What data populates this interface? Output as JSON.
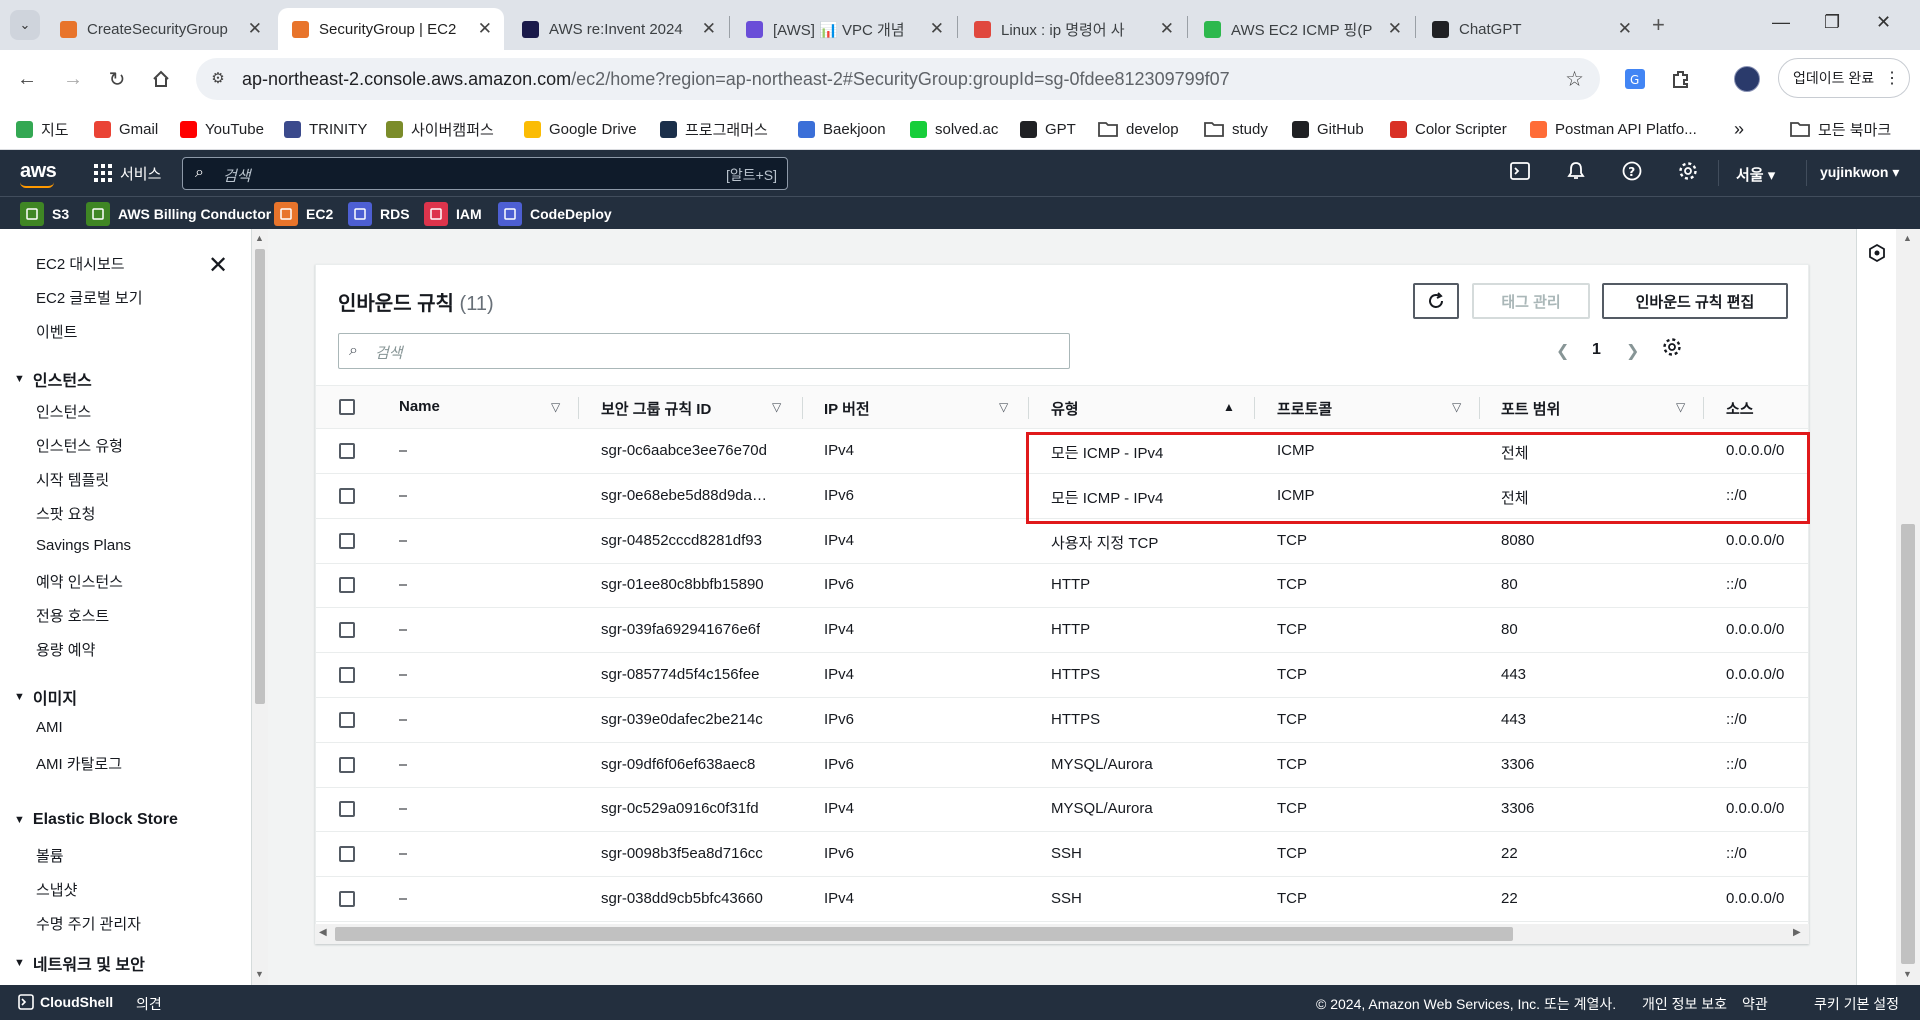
{
  "browser": {
    "tabs": [
      {
        "title": "CreateSecurityGroup",
        "fav_color": "#e8742b",
        "active": false
      },
      {
        "title": "SecurityGroup | EC2",
        "fav_color": "#e8742b",
        "active": true
      },
      {
        "title": "AWS re:Invent 2024",
        "fav_color": "#1a1a4a",
        "active": false
      },
      {
        "title": "[AWS] 📊 VPC 개념",
        "fav_color": "#6a4ed8",
        "active": false
      },
      {
        "title": "Linux : ip 명령어 사",
        "fav_color": "#e0483e",
        "active": false
      },
      {
        "title": "AWS EC2 ICMP 핑(P",
        "fav_color": "#2db84d",
        "active": false
      },
      {
        "title": "ChatGPT",
        "fav_color": "#202124",
        "active": false
      }
    ],
    "url_domain": "ap-northeast-2.console.aws.amazon.com",
    "url_path": "/ec2/home?region=ap-northeast-2#SecurityGroup:groupId=sg-0fdee812309799f07",
    "update_label": "업데이트 완료",
    "bookmarks": [
      {
        "label": "지도",
        "color": "#34a853"
      },
      {
        "label": "Gmail",
        "color": "#ea4335"
      },
      {
        "label": "YouTube",
        "color": "#ff0000"
      },
      {
        "label": "TRINITY",
        "color": "#3b4a8c"
      },
      {
        "label": "사이버캠퍼스",
        "color": "#7b8c2a"
      },
      {
        "label": "Google Drive",
        "color": "#fbbc04"
      },
      {
        "label": "프로그래머스",
        "color": "#1b2f4a"
      },
      {
        "label": "Baekjoon",
        "color": "#3b6fd8"
      },
      {
        "label": "solved.ac",
        "color": "#17ce3a"
      },
      {
        "label": "GPT",
        "color": "#202124"
      },
      {
        "label": "develop",
        "color": "#ffffff"
      },
      {
        "label": "study",
        "color": "#ffffff"
      },
      {
        "label": "GitHub",
        "color": "#202124"
      },
      {
        "label": "Color Scripter",
        "color": "#d93025"
      },
      {
        "label": "Postman API Platfo...",
        "color": "#ff6c37"
      }
    ],
    "bookmarks_more": "»",
    "all_bookmarks": "모든 북마크"
  },
  "aws": {
    "services_label": "서비스",
    "search_placeholder": "검색",
    "search_shortcut": "[알트+S]",
    "region": "서울 ▾",
    "user": "yujinkwon ▾",
    "favorites": [
      {
        "label": "S3",
        "color": "#3f8624"
      },
      {
        "label": "AWS Billing Conductor",
        "color": "#3f8624"
      },
      {
        "label": "EC2",
        "color": "#e8742b"
      },
      {
        "label": "RDS",
        "color": "#4d5fd3"
      },
      {
        "label": "IAM",
        "color": "#dd344c"
      },
      {
        "label": "CodeDeploy",
        "color": "#4d5fd3"
      }
    ]
  },
  "sidebar": {
    "top_links": [
      "EC2 대시보드",
      "EC2 글로벌 보기",
      "이벤트"
    ],
    "sections": [
      {
        "title": "인스턴스",
        "items": [
          "인스턴스",
          "인스턴스 유형",
          "시작 템플릿",
          "스팟 요청",
          "Savings Plans",
          "예약 인스턴스",
          "전용 호스트",
          "용량 예약"
        ]
      },
      {
        "title": "이미지",
        "items": [
          "AMI",
          "AMI 카탈로그"
        ]
      },
      {
        "title": "Elastic Block Store",
        "items": [
          "볼륨",
          "스냅샷",
          "수명 주기 관리자"
        ]
      },
      {
        "title": "네트워크 및 보안",
        "items": []
      }
    ]
  },
  "panel": {
    "title": "인바운드 규칙",
    "count": "(11)",
    "manage_tags": "태그 관리",
    "edit_rules": "인바운드 규칙 편집",
    "filter_placeholder": "검색",
    "page": "1",
    "columns": [
      "Name",
      "보안 그룹 규칙 ID",
      "IP 버전",
      "유형",
      "프로토콜",
      "포트 범위",
      "소스"
    ],
    "rows": [
      [
        "–",
        "sgr-0c6aabce3ee76e70d",
        "IPv4",
        "모든 ICMP - IPv4",
        "ICMP",
        "전체",
        "0.0.0.0/0"
      ],
      [
        "–",
        "sgr-0e68ebe5d88d9da…",
        "IPv6",
        "모든 ICMP - IPv4",
        "ICMP",
        "전체",
        "::/0"
      ],
      [
        "–",
        "sgr-04852cccd8281df93",
        "IPv4",
        "사용자 지정 TCP",
        "TCP",
        "8080",
        "0.0.0.0/0"
      ],
      [
        "–",
        "sgr-01ee80c8bbfb15890",
        "IPv6",
        "HTTP",
        "TCP",
        "80",
        "::/0"
      ],
      [
        "–",
        "sgr-039fa692941676e6f",
        "IPv4",
        "HTTP",
        "TCP",
        "80",
        "0.0.0.0/0"
      ],
      [
        "–",
        "sgr-085774d5f4c156fee",
        "IPv4",
        "HTTPS",
        "TCP",
        "443",
        "0.0.0.0/0"
      ],
      [
        "–",
        "sgr-039e0dafec2be214c",
        "IPv6",
        "HTTPS",
        "TCP",
        "443",
        "::/0"
      ],
      [
        "–",
        "sgr-09df6f06ef638aec8",
        "IPv6",
        "MYSQL/Aurora",
        "TCP",
        "3306",
        "::/0"
      ],
      [
        "–",
        "sgr-0c529a0916c0f31fd",
        "IPv4",
        "MYSQL/Aurora",
        "TCP",
        "3306",
        "0.0.0.0/0"
      ],
      [
        "–",
        "sgr-0098b3f5ea8d716cc",
        "IPv6",
        "SSH",
        "TCP",
        "22",
        "::/0"
      ],
      [
        "–",
        "sgr-038dd9cb5bfc43660",
        "IPv4",
        "SSH",
        "TCP",
        "22",
        "0.0.0.0/0"
      ]
    ]
  },
  "footer": {
    "cloudshell": "CloudShell",
    "feedback": "의견",
    "copyright": "© 2024, Amazon Web Services, Inc. 또는 계열사.",
    "privacy": "개인 정보 보호",
    "terms": "약관",
    "cookies": "쿠키 기본 설정"
  },
  "colors": {
    "aws_nav": "#232f3e",
    "highlight_box": "#e0191b",
    "aws_orange": "#ff9900"
  }
}
